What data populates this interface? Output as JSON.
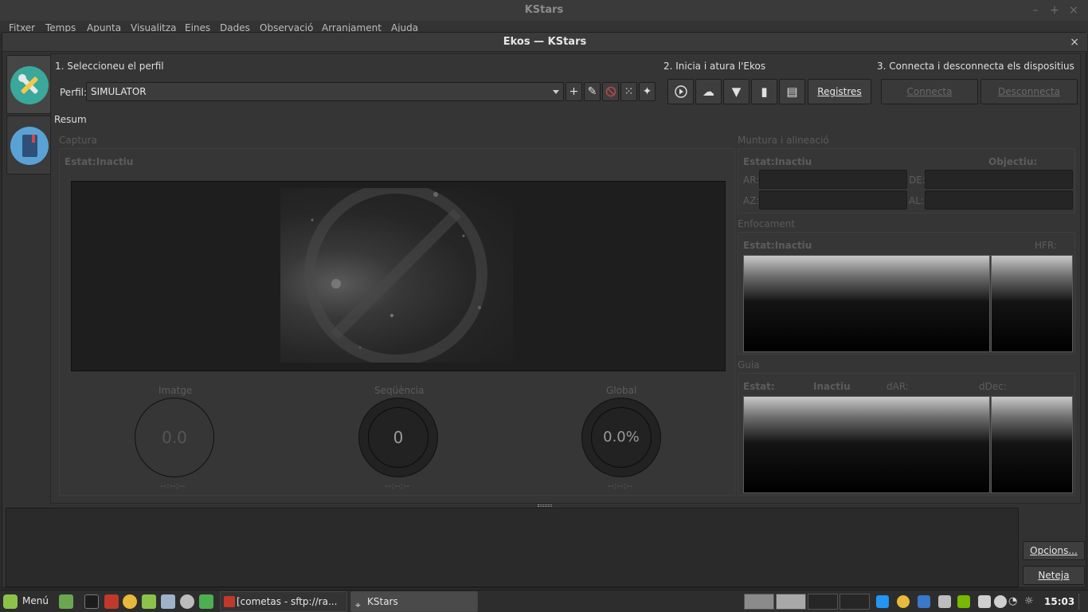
{
  "outer_window": {
    "title": "KStars",
    "controls": {
      "minimize": "–",
      "maximize": "+",
      "close": "×"
    }
  },
  "menubar": [
    "Fitxer",
    "Temps",
    "Apunta",
    "Visualitza",
    "Eines",
    "Dades",
    "Observació",
    "Arranjament",
    "Ajuda"
  ],
  "ekos": {
    "title": "Ekos — KStars",
    "close": "×",
    "step1": "1. Seleccioneu el perfil",
    "step2": "2. Inicia i atura l'Ekos",
    "step3": "3. Connecta i desconnecta els dispositius",
    "profile_label": "Perfil:",
    "profile_value": "SIMULATOR",
    "profile_tools": {
      "add": "+",
      "edit": "✎",
      "delete": "⃠",
      "wizard_random": "⁙",
      "magic": "✦"
    },
    "start_tools": {
      "start": "▶",
      "cloud": "☁",
      "devices": "▼",
      "usb": "▮",
      "indi": "▤"
    },
    "logs_button": "Registres",
    "connect_button": "Connecta",
    "disconnect_button": "Desconnecta",
    "summary_tab": "Resum",
    "capture": {
      "title": "Captura",
      "status_label": "Estat:",
      "status_value": "Inactiu",
      "image_label": "Imatge",
      "image_value": "0.0",
      "image_time": "--:--:--",
      "sequence_label": "Seqüència",
      "sequence_value": "0",
      "sequence_time": "--:--:--",
      "global_label": "Global",
      "global_value": "0.0%",
      "global_time": "--:--:--"
    },
    "mount": {
      "title": "Muntura i alineació",
      "status_label": "Estat:",
      "status_value": "Inactiu",
      "target_label": "Objectiu:",
      "ra_label": "AR:",
      "dec_label": "DE:",
      "az_label": "AZ:",
      "alt_label": "AL:"
    },
    "focus": {
      "title": "Enfocament",
      "status_label": "Estat:",
      "status_value": "Inactiu",
      "hfr_label": "HFR:"
    },
    "guide": {
      "title": "Guia",
      "status_label": "Estat:",
      "status_value": "Inactiu",
      "dra_label": "dAR:",
      "ddec_label": "dDec:"
    },
    "options_button": "Opcions...",
    "clear_button": "Neteja"
  },
  "taskbar": {
    "menu_label": "Menú",
    "task1": "[cometas - sftp://ra...",
    "task2": "KStars",
    "clock": "15:03"
  },
  "colors": {
    "accent_teal": "#3aa89a",
    "panel_bg": "#353535",
    "mint_green": "#8bc34a"
  }
}
